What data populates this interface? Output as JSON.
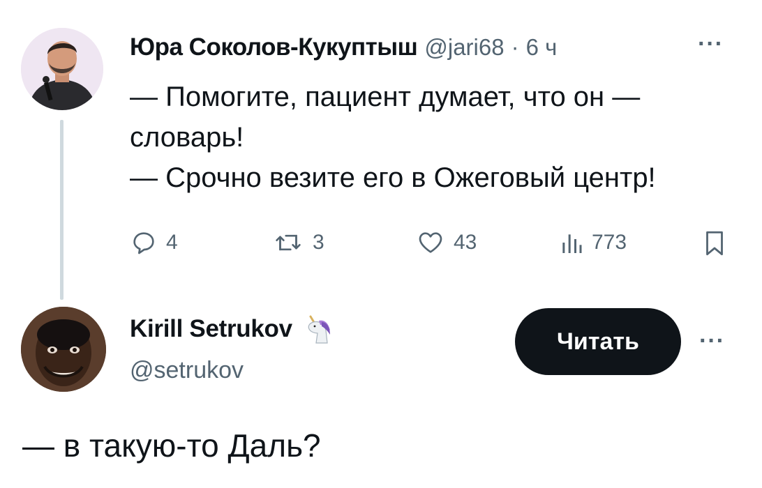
{
  "tweet1": {
    "author_name": "Юра Соколов-Кукуптыш",
    "handle": "@jari68",
    "separator": "·",
    "time": "6 ч",
    "more": "···",
    "lines": [
      "— Помогите, пациент думает, что он —",
      "словарь!",
      "— Срочно везите его в Ожеговый центр!"
    ],
    "actions": {
      "replies": "4",
      "reposts": "3",
      "likes": "43",
      "views": "773"
    },
    "icons": {
      "reply": "reply-bubble-icon",
      "repost": "repost-arrows-icon",
      "like": "heart-icon",
      "views": "views-bars-icon",
      "bookmark": "bookmark-icon"
    }
  },
  "tweet2": {
    "author_name": "Kirill Setrukov",
    "badge_icon": "unicorn-icon",
    "handle": "@setrukov",
    "follow_label": "Читать",
    "more": "···",
    "text": "— в такую-то Даль?"
  },
  "colors": {
    "text": "#0f1419",
    "secondary": "#536471",
    "thread_line": "#cfd9de",
    "button_bg": "#0f1419",
    "button_text": "#ffffff"
  }
}
